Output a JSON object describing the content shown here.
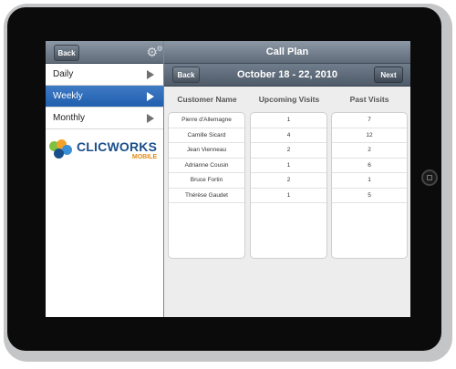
{
  "sidebar": {
    "back_label": "Back",
    "items": [
      {
        "label": "Daily",
        "active": false
      },
      {
        "label": "Weekly",
        "active": true
      },
      {
        "label": "Monthly",
        "active": false
      }
    ],
    "logo": {
      "main": "CLICWORKS",
      "sub": "MOBILE"
    }
  },
  "header": {
    "title": "Call Plan",
    "date_range": "October 18 - 22, 2010",
    "back_label": "Back",
    "next_label": "Next"
  },
  "table": {
    "headers": [
      "Customer Name",
      "Upcoming Visits",
      "Past Visits"
    ],
    "rows": [
      {
        "name": "Pierre d'Allemagne",
        "upcoming": "1",
        "past": "7"
      },
      {
        "name": "Camille Sicard",
        "upcoming": "4",
        "past": "12"
      },
      {
        "name": "Jean Vienneau",
        "upcoming": "2",
        "past": "2"
      },
      {
        "name": "Adrianne Cousin",
        "upcoming": "1",
        "past": "6"
      },
      {
        "name": "Bruce Fortin",
        "upcoming": "2",
        "past": "1"
      },
      {
        "name": "Thérèse Gaudet",
        "upcoming": "1",
        "past": "5"
      }
    ]
  },
  "colors": {
    "accent": "#2f6bb8",
    "toolbar": "#6b7786",
    "logo_blue": "#1b4f8c",
    "logo_orange": "#e08a18"
  },
  "icons": {
    "settings": "gear-icon",
    "menu_arrow": "triangle-right-icon",
    "device_home": "home-button-icon"
  }
}
